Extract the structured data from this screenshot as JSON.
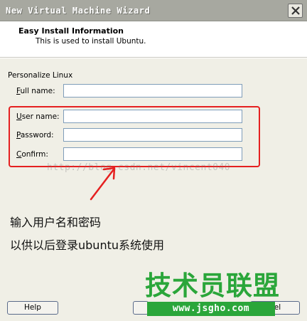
{
  "window": {
    "title": "New Virtual Machine Wizard"
  },
  "header": {
    "title": "Easy Install Information",
    "subtitle": "This is used to install Ubuntu."
  },
  "section": {
    "label": "Personalize Linux"
  },
  "fields": {
    "full_name": {
      "label_access": "F",
      "label_rest": "ull name:",
      "value": ""
    },
    "user_name": {
      "label_access": "U",
      "label_rest": "ser name:",
      "value": ""
    },
    "password": {
      "label_access": "P",
      "label_rest": "assword:",
      "value": ""
    },
    "confirm": {
      "label_access": "C",
      "label_rest": "onfirm:",
      "value": ""
    }
  },
  "annotations": {
    "line1": "输入用户名和密码",
    "line2": "以供以后登录ubuntu系统使用"
  },
  "watermark": {
    "url": "http://blog.csdn.net/vincent040",
    "logo_text": "技术员联盟",
    "logo_url": "www.jsgho.com"
  },
  "buttons": {
    "help": "Help",
    "cancel_visible": "cel"
  },
  "colors": {
    "highlight": "#e52020",
    "logo": "#2aa63a"
  },
  "icons": {
    "close": "close-icon",
    "arrow": "red-arrow-icon"
  }
}
